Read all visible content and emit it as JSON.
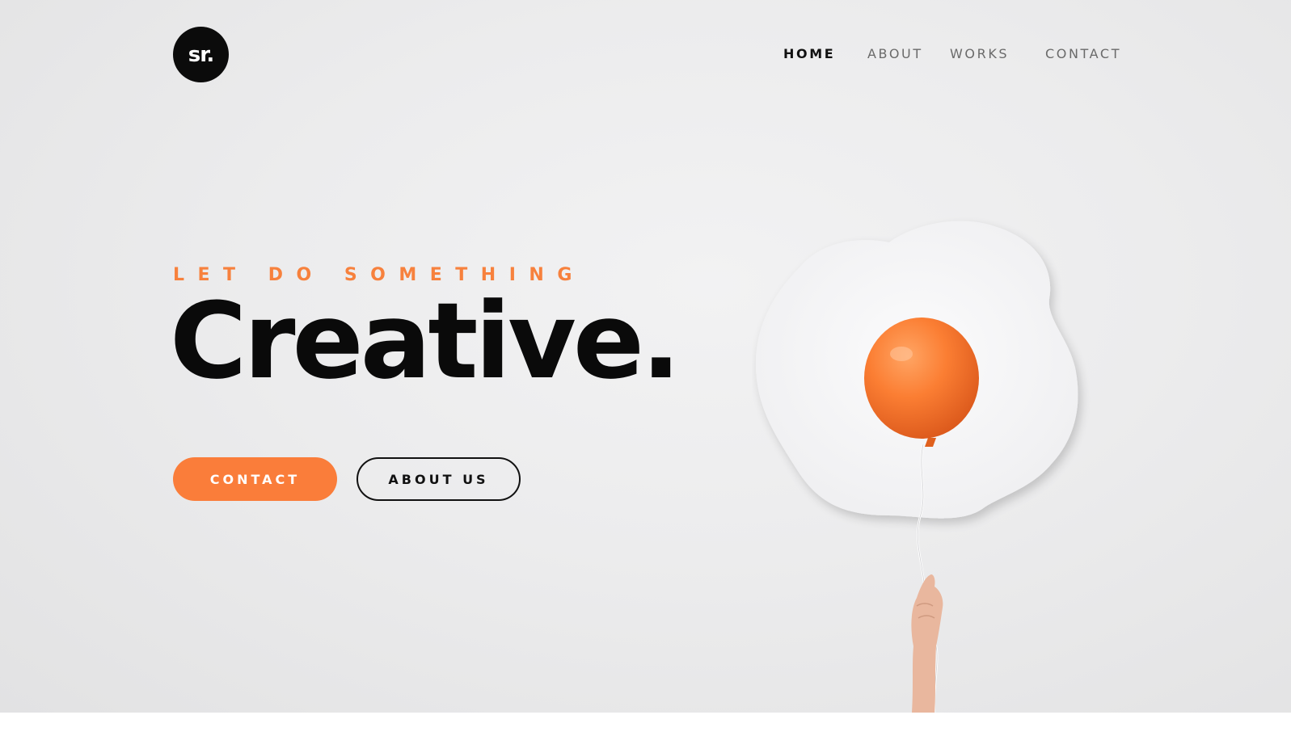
{
  "logo": {
    "text": "sr."
  },
  "nav": {
    "items": [
      {
        "label": "HOME",
        "active": true
      },
      {
        "label": "ABOUT",
        "active": false
      },
      {
        "label": "WORKS",
        "active": false
      },
      {
        "label": "CONTACT",
        "active": false
      }
    ]
  },
  "hero": {
    "eyebrow": "LET DO SOMETHING",
    "headline": "Creative.",
    "primary_button": "CONTACT",
    "secondary_button": "ABOUT US"
  },
  "illustration": {
    "icons": [
      "fried-egg-shape",
      "orange-balloon",
      "hand-holding-string"
    ]
  },
  "colors": {
    "accent": "#fa7d3a",
    "eyebrow": "#f7813d",
    "text_dark": "#0a0a0a",
    "nav_inactive": "#6a6a6a",
    "background": "#ececed"
  }
}
